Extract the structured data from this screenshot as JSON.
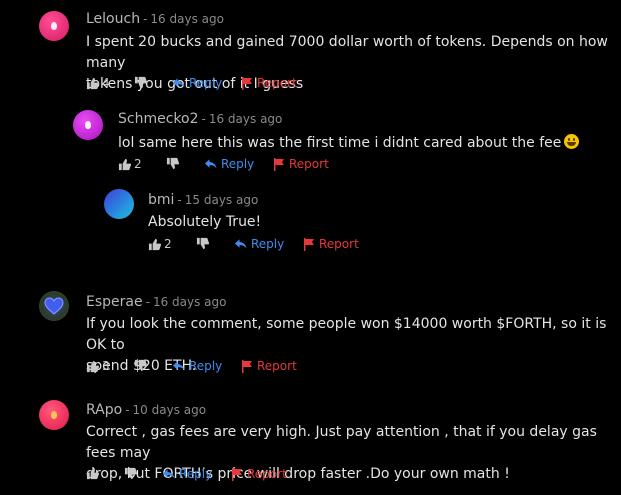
{
  "comments": [
    {
      "author": "Lelouch",
      "time": "16 days ago",
      "text_lines": [
        "I spent 20 bucks and gained 7000 dollar worth of tokens. Depends on how many",
        "tokens you got out of it I guess"
      ],
      "likes": "4",
      "reply": "Reply",
      "report": "Report",
      "avatar_color": "#e8337a"
    },
    {
      "author": "Schmecko2",
      "time": "16 days ago",
      "text_lines": [
        "lol same here this was the first time i didnt cared about the fee"
      ],
      "likes": "2",
      "reply": "Reply",
      "report": "Report",
      "avatar_color": "#c41ad6",
      "emoji": "grinning-face"
    },
    {
      "author": "bmi",
      "time": "15 days ago",
      "text_lines": [
        "Absolutely True!"
      ],
      "likes": "2",
      "reply": "Reply",
      "report": "Report",
      "avatar_color": "#2e6bd6"
    },
    {
      "author": "Esperae",
      "time": "16 days ago",
      "text_lines": [
        "If you look the comment, some people won $14000 worth $FORTH, so it is OK to",
        "spend $20 ETH."
      ],
      "likes": "3",
      "reply": "Reply",
      "report": "Report",
      "avatar_color": "#4a5fd0"
    },
    {
      "author": "RApo",
      "time": "10 days ago",
      "text_lines": [
        "Correct , gas fees are very high. Just pay attention , that if you delay gas fees may",
        "drop, but FORTH’s price will drop faster .Do your own math !"
      ],
      "likes": "",
      "reply": "Reply",
      "report": "Report",
      "avatar_color": "#f0305a"
    }
  ],
  "separator": "-",
  "icons": {
    "like": "thumbs-up-icon",
    "dislike": "thumbs-down-icon",
    "reply": "reply-arrow-icon",
    "report": "flag-icon"
  },
  "colors": {
    "background": "#000000",
    "reply": "#3d8ef0",
    "report": "#e5383b"
  }
}
